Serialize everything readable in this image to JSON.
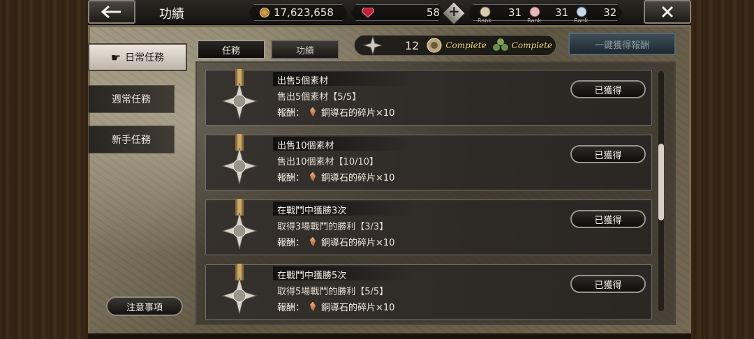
{
  "header": {
    "title": "功績",
    "gold": "17,623,658",
    "gems": "58",
    "ranks": [
      {
        "label": "Rank",
        "value": "31"
      },
      {
        "label": "Rank",
        "value": "31"
      },
      {
        "label": "Rank",
        "value": "32"
      }
    ]
  },
  "side_menu": [
    {
      "label": "日常任務",
      "active": true
    },
    {
      "label": "週常任務",
      "active": false
    },
    {
      "label": "新手任務",
      "active": false
    }
  ],
  "notice_label": "注意事項",
  "top_tabs": [
    {
      "label": "任務",
      "active": true
    },
    {
      "label": "功績",
      "active": false
    }
  ],
  "progress": {
    "count": "12",
    "badge1": "Complete",
    "badge2": "Complete"
  },
  "claim_all_label": "一鍵獲得報酬",
  "quests": [
    {
      "title": "出售5個素材",
      "desc": "售出5個素材【5/5】",
      "reward_label": "報酬：",
      "reward": "銅導石的碎片×10",
      "button": "已獲得"
    },
    {
      "title": "出售10個素材",
      "desc": "售出10個素材【10/10】",
      "reward_label": "報酬：",
      "reward": "銅導石的碎片×10",
      "button": "已獲得"
    },
    {
      "title": "在戰鬥中獲勝3次",
      "desc": "取得3場戰鬥的勝利【3/3】",
      "reward_label": "報酬：",
      "reward": "銅導石的碎片×10",
      "button": "已獲得"
    },
    {
      "title": "在戰鬥中獲勝5次",
      "desc": "取得5場戰鬥的勝利【5/5】",
      "reward_label": "報酬：",
      "reward": "銅導石的碎片×10",
      "button": "已獲得"
    }
  ]
}
